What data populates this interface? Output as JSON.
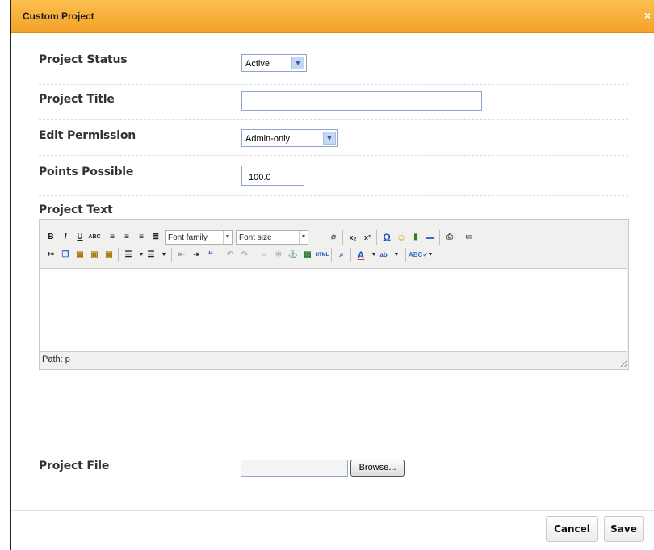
{
  "dialog": {
    "title": "Custom Project",
    "close_glyph": "×"
  },
  "fields": {
    "status": {
      "label": "Project Status",
      "value": "Active"
    },
    "title": {
      "label": "Project Title",
      "value": ""
    },
    "permission": {
      "label": "Edit Permission",
      "value": "Admin-only"
    },
    "points": {
      "label": "Points Possible",
      "value": "100.0"
    },
    "text": {
      "label": "Project Text"
    },
    "file": {
      "label": "Project File",
      "browse_label": "Browse..."
    }
  },
  "editor": {
    "font_family": "Font family",
    "font_size": "Font size",
    "path": "Path: p",
    "icons": [
      "bold-icon",
      "italic-icon",
      "underline-icon",
      "strikethrough-icon",
      "align-left-icon",
      "align-center-icon",
      "align-right-icon",
      "align-justify-icon",
      "horizontal-rule-icon",
      "eraser-icon",
      "subscript-icon",
      "superscript-icon",
      "special-char-icon",
      "emoticon-icon",
      "media-icon",
      "hr-icon",
      "print-icon",
      "pagebreak-icon",
      "cut-icon",
      "copy-icon",
      "paste-icon",
      "paste-text-icon",
      "paste-word-icon",
      "bullet-list-icon",
      "numbered-list-icon",
      "outdent-icon",
      "indent-icon",
      "blockquote-icon",
      "undo-icon",
      "redo-icon",
      "link-icon",
      "unlink-icon",
      "anchor-icon",
      "image-icon",
      "html-icon",
      "preview-icon",
      "font-color-icon",
      "highlight-icon",
      "spellcheck-icon"
    ]
  },
  "footer": {
    "cancel_label": "Cancel",
    "save_label": "Save"
  },
  "colors": {
    "titlebar": "#f3a22a",
    "select_arrow": "#c6d7f3"
  }
}
